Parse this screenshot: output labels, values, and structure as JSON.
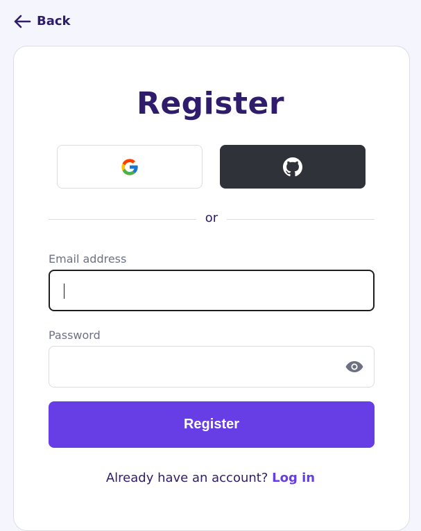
{
  "nav": {
    "back_label": "Back"
  },
  "form": {
    "title": "Register",
    "divider_text": "or",
    "email_label": "Email address",
    "email_value": "",
    "password_label": "Password",
    "password_value": "",
    "submit_label": "Register"
  },
  "social": {
    "google_icon": "google-icon",
    "github_icon": "github-icon"
  },
  "footer": {
    "prompt": "Already have an account?",
    "link_label": "Log in"
  },
  "colors": {
    "accent": "#673de6",
    "heading": "#2f1c6a",
    "github_bg": "#2f3339",
    "page_bg": "#f5f5fd"
  }
}
